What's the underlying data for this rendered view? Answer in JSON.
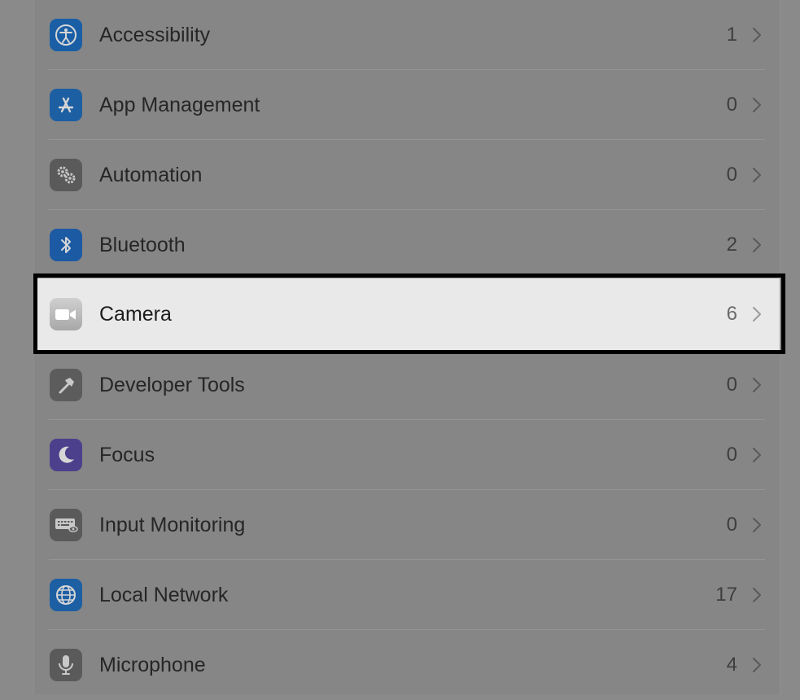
{
  "list": {
    "items": [
      {
        "label": "Accessibility",
        "count": "1",
        "icon": "accessibility-icon",
        "icon_color": "#1a5fa6"
      },
      {
        "label": "App Management",
        "count": "0",
        "icon": "app-store-icon",
        "icon_color": "#1d5fa3"
      },
      {
        "label": "Automation",
        "count": "0",
        "icon": "gears-icon",
        "icon_color": "#5a5a5a"
      },
      {
        "label": "Bluetooth",
        "count": "2",
        "icon": "bluetooth-icon",
        "icon_color": "#1c5aa4"
      },
      {
        "label": "Camera",
        "count": "6",
        "icon": "camera-icon",
        "icon_color": "#b8b8b8",
        "selected": true
      },
      {
        "label": "Developer Tools",
        "count": "0",
        "icon": "hammer-icon",
        "icon_color": "#5c5c5c"
      },
      {
        "label": "Focus",
        "count": "0",
        "icon": "moon-icon",
        "icon_color": "#4c3f8c"
      },
      {
        "label": "Input Monitoring",
        "count": "0",
        "icon": "keyboard-icon",
        "icon_color": "#5a5a5a"
      },
      {
        "label": "Local Network",
        "count": "17",
        "icon": "globe-icon",
        "icon_color": "#1d5fa3"
      },
      {
        "label": "Microphone",
        "count": "4",
        "icon": "microphone-icon",
        "icon_color": "#5a5a5a"
      }
    ]
  },
  "colors": {
    "dim_background": "#868686",
    "selected_row": "#e9e9e9",
    "highlight_border": "#000000"
  }
}
